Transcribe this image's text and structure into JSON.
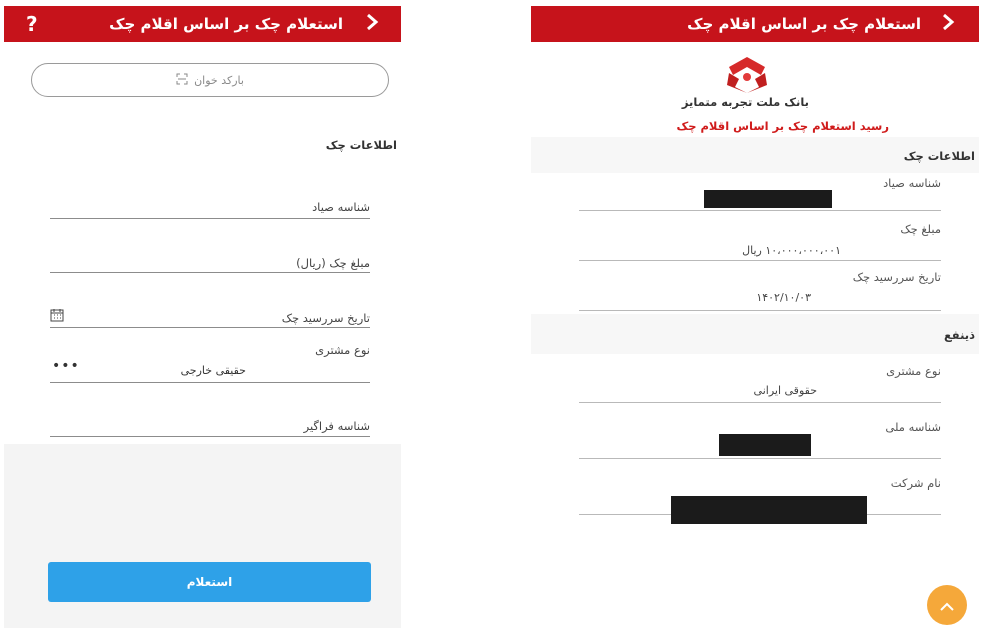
{
  "left_screen": {
    "header": {
      "title": "استعلام چک بر اساس اقلام چک",
      "back_icon": "chevron-icon",
      "help_label": "?"
    },
    "barcode_button": {
      "label": "بارکد خوان",
      "icon": "scan-icon"
    },
    "section_title": "اطلاعات چک",
    "fields": {
      "sayad_id": {
        "label": "شناسه صیاد"
      },
      "amount": {
        "label": "مبلغ چک (ریال)"
      },
      "due_date": {
        "label": "تاریخ سررسید چک",
        "icon": "calendar-icon"
      },
      "customer_type": {
        "label": "نوع مشتری",
        "value": "حقیقی خارجی",
        "more_icon": "more-dots-icon"
      },
      "universal_id": {
        "label": "شناسه فراگیر"
      }
    },
    "submit_label": "استعلام",
    "colors": {
      "header": "#c6131b",
      "button": "#2ea1e8"
    }
  },
  "right_screen": {
    "header": {
      "title": "استعلام چک بر اساس اقلام چک",
      "back_icon": "chevron-icon"
    },
    "logo": "bank-mellat-logo",
    "bank_name": "بانک ملت تجربه متمایز",
    "receipt_title": "رسید استعلام چک بر اساس اقلام چک",
    "check_info": {
      "title": "اطلاعات چک",
      "sayad_label": "شناسه صیاد",
      "amount_label": "مبلغ چک",
      "amount_value": "۱۰،۰۰۰،۰۰۰،۰۰۱ ریال",
      "due_label": "تاریخ سررسید چک",
      "due_value": "۱۴۰۲/۱۰/۰۳"
    },
    "beneficiary": {
      "title": "ذینفع",
      "customer_type_label": "نوع مشتری",
      "customer_type_value": "حقوقی ایرانی",
      "national_id_label": "شناسه ملی",
      "company_label": "نام شرکت"
    },
    "fab_icon": "chevron-up-icon",
    "colors": {
      "header": "#c6131b",
      "receipt_title": "#d01c1c",
      "fab": "#f5a83a"
    }
  }
}
